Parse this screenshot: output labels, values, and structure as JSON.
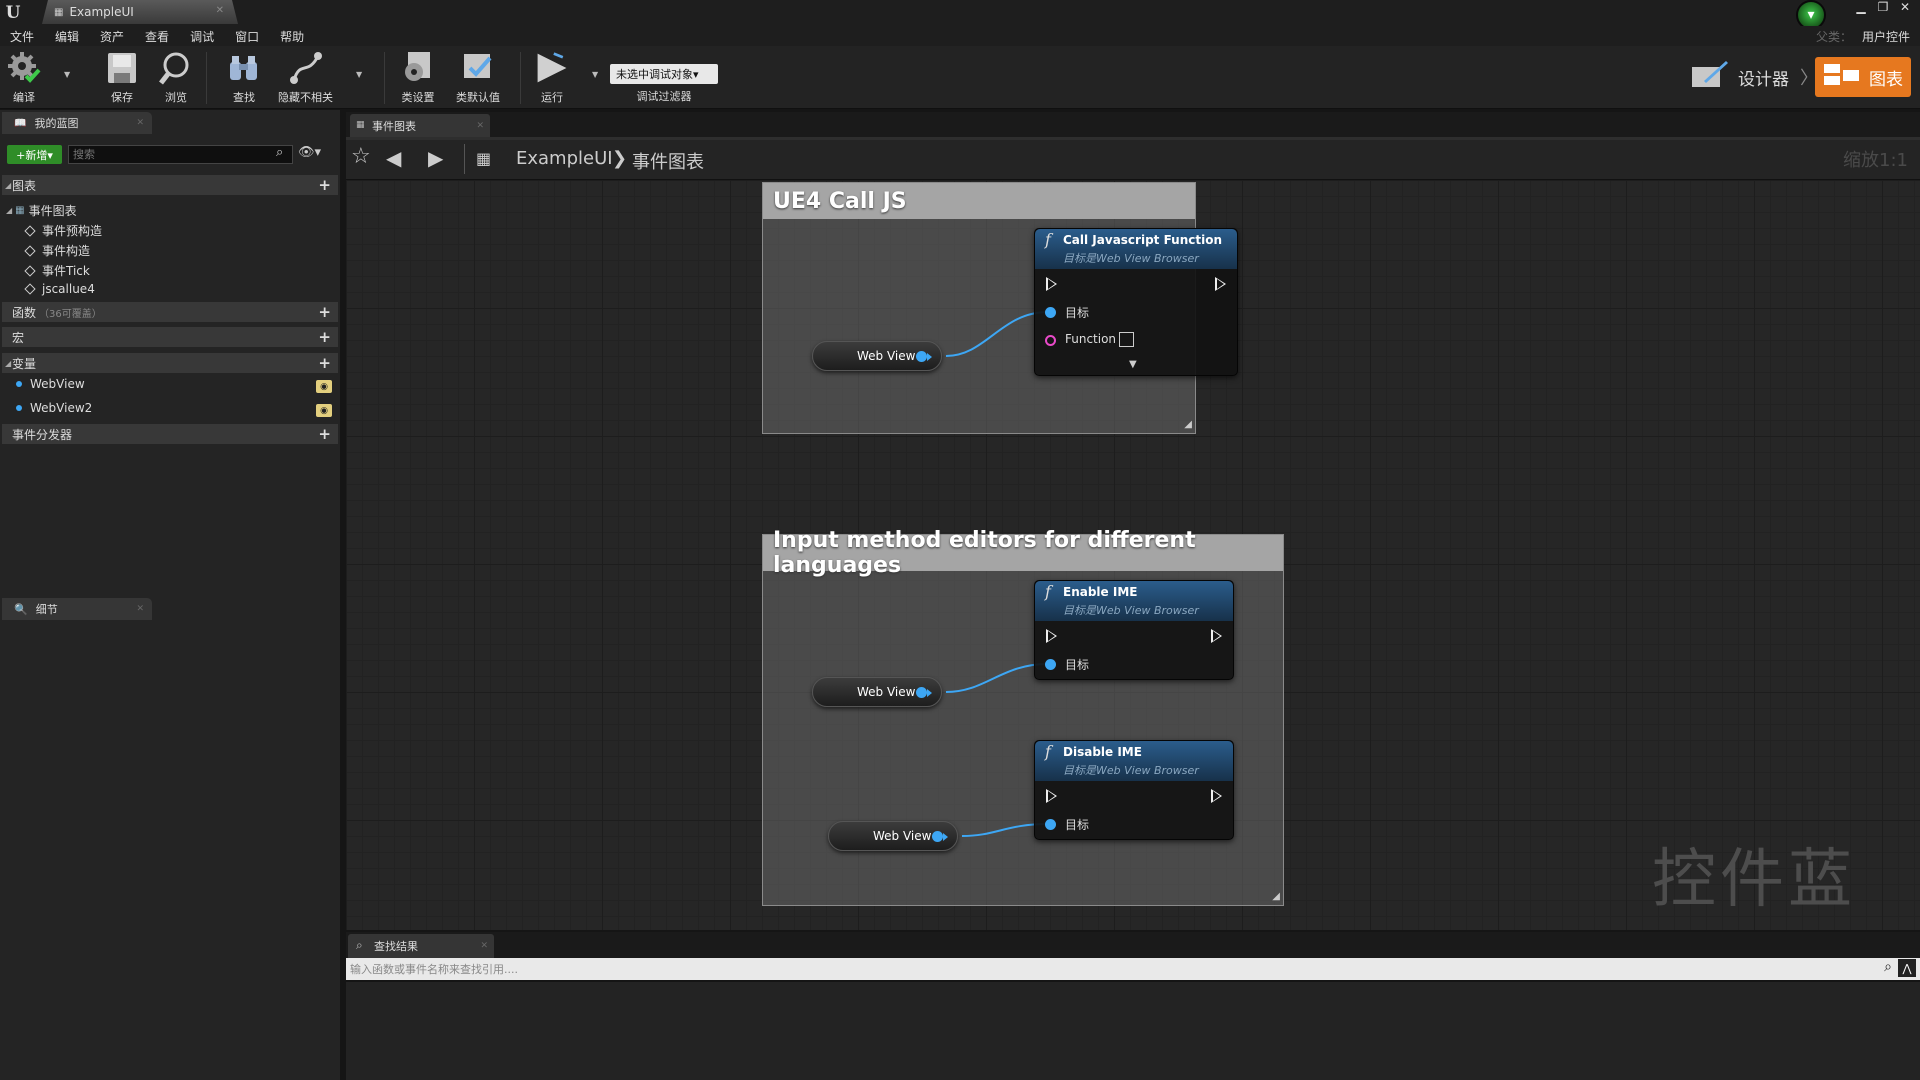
{
  "window": {
    "tab_title": "ExampleUI",
    "app_logo": "U"
  },
  "menu": [
    "文件",
    "编辑",
    "资产",
    "查看",
    "调试",
    "窗口",
    "帮助"
  ],
  "parent_class": {
    "label": "父类：",
    "value": "用户控件"
  },
  "toolbar": {
    "compile": "编译",
    "save": "保存",
    "browse": "浏览",
    "find": "查找",
    "hide_unrelated": "隐藏不相关",
    "class_settings": "类设置",
    "class_defaults": "类默认值",
    "play": "运行",
    "debug_object": "未选中调试对象▾",
    "debug_filter": "调试过滤器"
  },
  "modes": {
    "designer": "设计器",
    "graph": "图表"
  },
  "my_blueprint": {
    "tab": "我的蓝图",
    "new_button": "+新增▾",
    "search_placeholder": "搜索",
    "sections": {
      "graphs": "图表",
      "functions": "函数",
      "functions_sub": "（36可覆盖）",
      "macros": "宏",
      "variables": "变量",
      "event_dispatchers": "事件分发器"
    },
    "event_graph": "事件图表",
    "events": [
      "事件预构造",
      "事件构造",
      "事件Tick",
      "jscallue4"
    ],
    "variables": [
      "WebView",
      "WebView2"
    ]
  },
  "details": {
    "tab": "细节"
  },
  "graph": {
    "tab": "事件图表",
    "breadcrumb": {
      "root": "ExampleUI",
      "sep": "❯",
      "current": "事件图表"
    },
    "zoom": "缩放1:1",
    "watermark": "控件蓝图",
    "comments": [
      "UE4 Call JS",
      "Input method editors for different languages"
    ],
    "nodes": {
      "call_js": {
        "title": "Call Javascript Function",
        "subtitle": "目标是Web View Browser",
        "pin_target": "目标",
        "pin_function": "Function"
      },
      "enable_ime": {
        "title": "Enable IME",
        "subtitle": "目标是Web View Browser",
        "pin_target": "目标"
      },
      "disable_ime": {
        "title": "Disable IME",
        "subtitle": "目标是Web View Browser",
        "pin_target": "目标"
      }
    },
    "var_node_label": "Web View"
  },
  "find_results": {
    "tab": "查找结果",
    "placeholder": "输入函数或事件名称来查找引用....",
    "icons": [
      "search-icon",
      "find-options-icon"
    ]
  },
  "colors": {
    "accent_orange": "#e6781f",
    "new_green": "#2f8d28",
    "object_pin_blue": "#3da7f5",
    "string_pin_pink": "#e94ac9",
    "function_header_blue": "#2b5d8c"
  }
}
